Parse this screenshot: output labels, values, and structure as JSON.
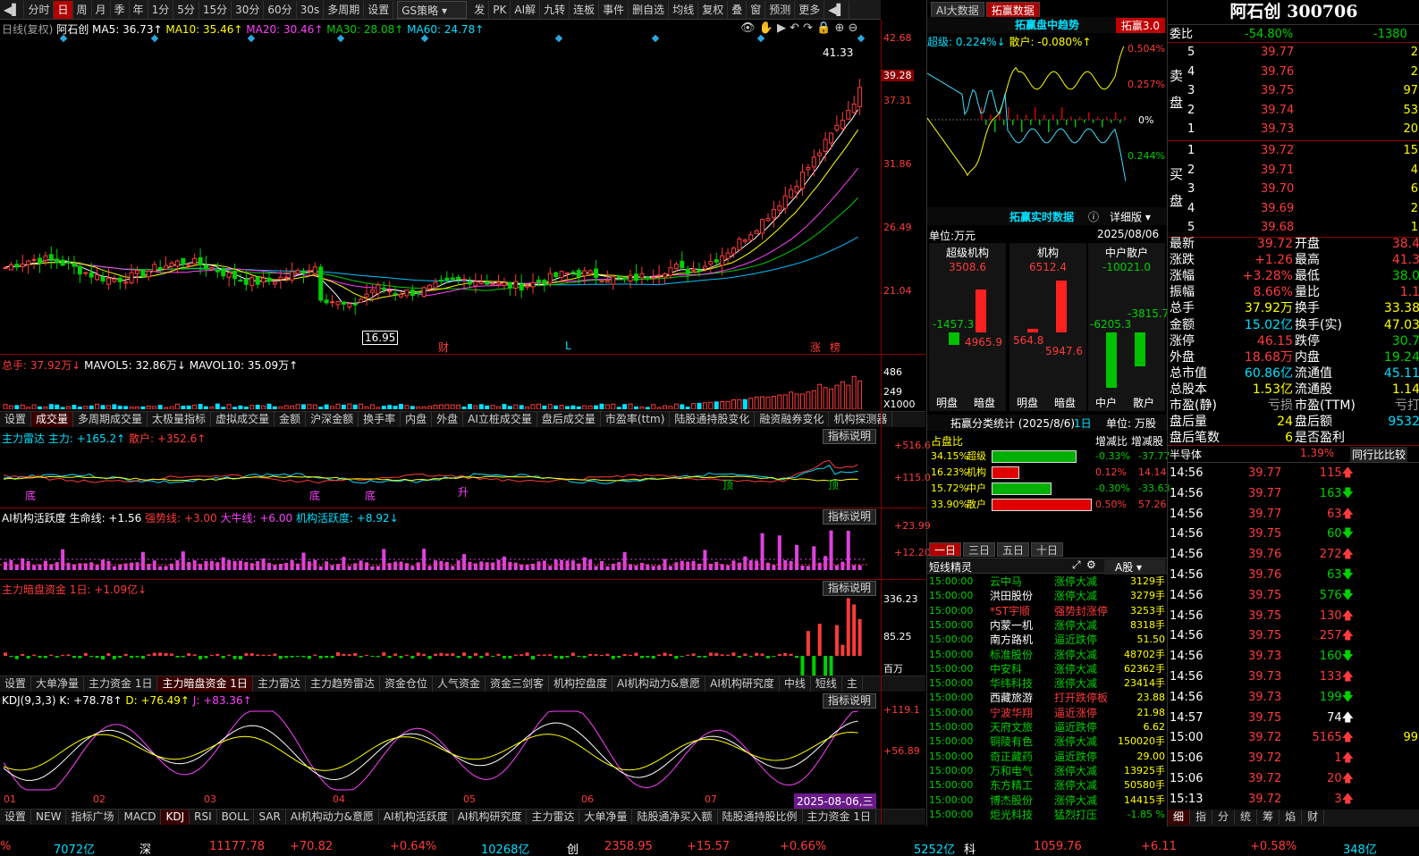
{
  "toolbar": {
    "items": [
      "分时",
      "日",
      "周",
      "月",
      "季",
      "年",
      "1分",
      "5分",
      "15分",
      "30分",
      "60分",
      "30s",
      "多周期",
      "设置"
    ],
    "active_index": 1,
    "strategy": "GS策略",
    "right_items": [
      "发",
      "PK",
      "AI解",
      "九转",
      "连板",
      "事件",
      "删自选",
      "均线",
      "复权",
      "叠",
      "窗",
      "预测",
      "更多"
    ]
  },
  "main": {
    "legend": {
      "prefix": "日线(复权)",
      "name": "阿石创",
      "ma5": "MA5: 36.73↑",
      "ma10": "MA10: 35.46↑",
      "ma20": "MA20: 30.46↑",
      "ma30": "MA30: 28.08↑",
      "ma60": "MA60: 24.78↑"
    },
    "high_label": "41.33",
    "low_label": "16.95",
    "markers": {
      "cai": "财",
      "L": "L",
      "zhang": "涨",
      "bang": "榜"
    },
    "price_axis": [
      "42.68",
      "37.31",
      "31.86",
      "26.49",
      "21.04"
    ],
    "current_price": "39.28"
  },
  "volume": {
    "legend": {
      "total": "总手: 37.92万↓",
      "mavol5": "MAVOL5: 32.86万↓",
      "mavol10": "MAVOL10: 35.09万↑"
    },
    "axis": [
      "486",
      "249"
    ],
    "unit": "X1000",
    "tabs": [
      "设置",
      "成交量",
      "多周期成交量",
      "太极量指标",
      "虚拟成交量",
      "金额",
      "沪深金额",
      "换手率",
      "内盘",
      "外盘",
      "AI立桩成交量",
      "盘后成交量",
      "市盈率(ttm)",
      "陆股通持股变化",
      "融资融券变化",
      "机构探测器"
    ],
    "active_tab": 1
  },
  "radar": {
    "legend": {
      "name": "主力雷达",
      "main": "主力: +165.2↑",
      "retail": "散户: +352.6↑"
    },
    "axis": [
      "+516.6",
      "+115.0"
    ],
    "marks": [
      "底",
      "升",
      "顶"
    ],
    "desc_button": "指标说明"
  },
  "ai_activity": {
    "legend": {
      "name": "AI机构活跃度",
      "life": "生命线: +1.56",
      "strong": "强势线: +3.00",
      "bull": "大牛线: +6.00",
      "act": "机构活跃度: +8.92↓"
    },
    "axis": [
      "+23.99",
      "+12.20"
    ],
    "desc_button": "指标说明"
  },
  "dark_fund": {
    "legend": "主力暗盘资金 1日: +1.09亿↓",
    "axis": [
      "336.23",
      "85.25"
    ],
    "unit": "百万",
    "desc_button": "指标说明",
    "tabs": [
      "设置",
      "大单净量",
      "主力资金 1日",
      "主力暗盘资金 1日",
      "主力雷达",
      "主力趋势雷达",
      "资金仓位",
      "人气资金",
      "资金三剑客",
      "机构控盘度",
      "AI机构动力&意愿",
      "AI机构研究度",
      "中线",
      "短线",
      "主"
    ],
    "active_tab": 3
  },
  "kdj": {
    "legend": {
      "name": "KDJ(9,3,3)",
      "k": "K: +78.78↑",
      "d": "D: +76.49↑",
      "j": "J: +83.36↑"
    },
    "axis": [
      "+119.1",
      "+56.89"
    ],
    "desc_button": "指标说明",
    "months": [
      "01",
      "02",
      "03",
      "04",
      "05",
      "06",
      "07"
    ],
    "date_label": "2025-08-06,三"
  },
  "bottom_tabs": {
    "items": [
      "设置",
      "NEW",
      "指标广场",
      "MACD",
      "KDJ",
      "RSI",
      "BOLL",
      "SAR",
      "AI机构动力&意愿",
      "AI机构活跃度",
      "AI机构研究度",
      "主力雷达",
      "大单净量",
      "陆股通净买入额",
      "陆股通持股比例",
      "主力资金 1日"
    ],
    "active_index": 4
  },
  "mid": {
    "tabs": [
      "AI大数据",
      "拓赢数据"
    ],
    "active_tab": 1,
    "trend_title": "拓赢盘中趋势",
    "trend_badge": "拓赢3.0",
    "super": "超级: 0.224%↓",
    "retail": "散户: -0.080%↑",
    "trend_axis": [
      "0.504%",
      "0.257%",
      "0%",
      "0.244%"
    ],
    "realtime_title": "拓赢实时数据",
    "detail": "详细版",
    "unit": "单位:万元",
    "date": "2025/08/06",
    "cols": [
      {
        "name": "超级机构",
        "top": "3508.6",
        "neg": "-1457.3",
        "pos": "4965.9"
      },
      {
        "name": "机构",
        "top": "6512.4",
        "neg": "564.8",
        "pos": "5947.6"
      },
      {
        "name": "中户散户",
        "top": "-10021.0",
        "neg": "-6205.3",
        "pos": "-3815.7"
      }
    ],
    "col_foot": [
      "明盘",
      "暗盘",
      "明盘",
      "暗盘",
      "中户",
      "散户"
    ],
    "stat_title": "拓赢分类统计 (2025/8/6)",
    "stat_period": "1日",
    "stat_unit": "单位: 万股",
    "stat_head": [
      "占盘比",
      "增减比",
      "增减股"
    ],
    "stats": [
      {
        "pct": "34.15%",
        "name": "超级",
        "chg": "-0.33%",
        "shares": "-37.77",
        "fill": 0.85,
        "color": "#00b000"
      },
      {
        "pct": "16.23%",
        "name": "机构",
        "chg": "0.12%",
        "shares": "14.14",
        "fill": 0.28,
        "color": "#e00000"
      },
      {
        "pct": "15.72%",
        "name": "中户",
        "chg": "-0.30%",
        "shares": "-33.63",
        "fill": 0.6,
        "color": "#00b000"
      },
      {
        "pct": "33.90%",
        "name": "散户",
        "chg": "0.50%",
        "shares": "57.26",
        "fill": 1.0,
        "color": "#e00000"
      }
    ],
    "period_tabs": [
      "一日",
      "三日",
      "五日",
      "十日"
    ],
    "elf_title": "短线精灵",
    "elf_market": "A股",
    "elf_rows": [
      {
        "t": "15:00:00",
        "n": "云中马",
        "e": "涨停大减",
        "v": "3129手"
      },
      {
        "t": "15:00:00",
        "n": "洪田股份",
        "e": "涨停大减",
        "v": "3279手"
      },
      {
        "t": "15:00:00",
        "n": "*ST宇顺",
        "e": "强势封涨停",
        "v": "3253手"
      },
      {
        "t": "15:00:00",
        "n": "内蒙一机",
        "e": "涨停大减",
        "v": "8318手"
      },
      {
        "t": "15:00:00",
        "n": "南方路机",
        "e": "逼近跌停",
        "v": "51.50"
      },
      {
        "t": "15:00:00",
        "n": "标准股份",
        "e": "涨停大减",
        "v": "48702手"
      },
      {
        "t": "15:00:00",
        "n": "中安科",
        "e": "涨停大减",
        "v": "62362手"
      },
      {
        "t": "15:00:00",
        "n": "华纬科技",
        "e": "涨停大减",
        "v": "23414手"
      },
      {
        "t": "15:00:00",
        "n": "西藏旅游",
        "e": "打开跌停板",
        "v": "23.88"
      },
      {
        "t": "15:00:00",
        "n": "宁波华翔",
        "e": "逼近涨停",
        "v": "21.98"
      },
      {
        "t": "15:00:00",
        "n": "天府文旅",
        "e": "逼近跌停",
        "v": "6.62"
      },
      {
        "t": "15:00:00",
        "n": "铜陵有色",
        "e": "涨停大减",
        "v": "150020手"
      },
      {
        "t": "15:00:00",
        "n": "奇正藏药",
        "e": "逼近跌停",
        "v": "29.00"
      },
      {
        "t": "15:00:00",
        "n": "万和电气",
        "e": "涨停大减",
        "v": "13925手"
      },
      {
        "t": "15:00:00",
        "n": "东方精工",
        "e": "涨停大减",
        "v": "50580手"
      },
      {
        "t": "15:00:00",
        "n": "博杰股份",
        "e": "涨停大减",
        "v": "14415手"
      },
      {
        "t": "15:00:00",
        "n": "炬光科技",
        "e": "猛烈打压",
        "v": "-1.85 %"
      }
    ]
  },
  "quote": {
    "title": "阿石创 300706",
    "weibi": {
      "label": "委比",
      "pct": "-54.80%",
      "val": "-1380"
    },
    "sell_label": "卖盘",
    "buy_label": "买盘",
    "sells": [
      {
        "n": "5",
        "p": "39.77",
        "v": "2"
      },
      {
        "n": "4",
        "p": "39.76",
        "v": "2"
      },
      {
        "n": "3",
        "p": "39.75",
        "v": "97"
      },
      {
        "n": "2",
        "p": "39.74",
        "v": "53"
      },
      {
        "n": "1",
        "p": "39.73",
        "v": "20"
      }
    ],
    "buys": [
      {
        "n": "1",
        "p": "39.72",
        "v": "15"
      },
      {
        "n": "2",
        "p": "39.71",
        "v": "4"
      },
      {
        "n": "3",
        "p": "39.70",
        "v": "6"
      },
      {
        "n": "4",
        "p": "39.69",
        "v": "2"
      },
      {
        "n": "5",
        "p": "39.68",
        "v": "1"
      }
    ],
    "stats": [
      {
        "l": "最新",
        "v": "39.72",
        "vc": "red",
        "l2": "开盘",
        "v2": "38.4",
        "v2c": "red"
      },
      {
        "l": "涨跌",
        "v": "+1.26",
        "vc": "red",
        "l2": "最高",
        "v2": "41.3",
        "v2c": "red"
      },
      {
        "l": "涨幅",
        "v": "+3.28%",
        "vc": "red",
        "l2": "最低",
        "v2": "38.0",
        "v2c": "grn"
      },
      {
        "l": "振幅",
        "v": "8.66%",
        "vc": "red",
        "l2": "量比",
        "v2": "1.1",
        "v2c": "red"
      },
      {
        "l": "总手",
        "v": "37.92万",
        "vc": "yel",
        "l2": "换手",
        "v2": "33.38",
        "v2c": "yel"
      },
      {
        "l": "金额",
        "v": "15.02亿",
        "vc": "cyn",
        "l2": "换手(实)",
        "v2": "47.03",
        "v2c": "yel"
      },
      {
        "l": "涨停",
        "v": "46.15",
        "vc": "red",
        "l2": "跌停",
        "v2": "30.7",
        "v2c": "grn"
      },
      {
        "l": "外盘",
        "v": "18.68万",
        "vc": "red",
        "l2": "内盘",
        "v2": "19.24",
        "v2c": "grn"
      },
      {
        "l": "总市值",
        "v": "60.86亿",
        "vc": "cyn",
        "l2": "流通值",
        "v2": "45.11",
        "v2c": "cyn"
      },
      {
        "l": "总股本",
        "v": "1.53亿",
        "vc": "yel",
        "l2": "流通股",
        "v2": "1.14",
        "v2c": "yel"
      },
      {
        "l": "市盈(静)",
        "v": "亏损",
        "vc": "gry",
        "l2": "市盈(TTM)",
        "v2": "亏打",
        "v2c": "gry"
      },
      {
        "l": "盘后量",
        "v": "24",
        "vc": "yel",
        "l2": "盘后额",
        "v2": "9532",
        "v2c": "cyn"
      },
      {
        "l": "盘后笔数",
        "v": "6",
        "vc": "yel",
        "l2": "是否盈利",
        "v2": "",
        "v2c": "gry"
      }
    ],
    "sector": {
      "name": "半导体",
      "pct": "1.39%",
      "btn": "同行比比较"
    },
    "ticks": [
      {
        "t": "14:56",
        "p": "39.77",
        "v": "115",
        "d": "up"
      },
      {
        "t": "14:56",
        "p": "39.77",
        "v": "163",
        "d": "down"
      },
      {
        "t": "14:56",
        "p": "39.77",
        "v": "63",
        "d": "up"
      },
      {
        "t": "14:56",
        "p": "39.75",
        "v": "60",
        "d": "down"
      },
      {
        "t": "14:56",
        "p": "39.76",
        "v": "272",
        "d": "up"
      },
      {
        "t": "14:56",
        "p": "39.76",
        "v": "63",
        "d": "down"
      },
      {
        "t": "14:56",
        "p": "39.75",
        "v": "576",
        "d": "down"
      },
      {
        "t": "14:56",
        "p": "39.75",
        "v": "130",
        "d": "up"
      },
      {
        "t": "14:56",
        "p": "39.75",
        "v": "257",
        "d": "up"
      },
      {
        "t": "14:56",
        "p": "39.73",
        "v": "160",
        "d": "down"
      },
      {
        "t": "14:56",
        "p": "39.73",
        "v": "133",
        "d": "up"
      },
      {
        "t": "14:56",
        "p": "39.73",
        "v": "199",
        "d": "down"
      },
      {
        "t": "14:57",
        "p": "39.75",
        "v": "74",
        "d": "up-w"
      },
      {
        "t": "15:00",
        "p": "39.72",
        "v": "5165",
        "d": "up",
        "x": "99"
      },
      {
        "t": "15:06",
        "p": "39.72",
        "v": "1",
        "d": "up"
      },
      {
        "t": "15:06",
        "p": "39.72",
        "v": "20",
        "d": "up"
      },
      {
        "t": "15:13",
        "p": "39.72",
        "v": "3",
        "d": "up"
      }
    ],
    "bottom_tabs": [
      "细",
      "指",
      "分",
      "统",
      "筹",
      "焰",
      "财"
    ]
  },
  "ticker": {
    "items": [
      {
        "t": "%",
        "c": "red"
      },
      {
        "t": "7072亿",
        "c": "cyn"
      },
      {
        "t": "深",
        "c": "wht"
      },
      {
        "t": "11177.78",
        "c": "red"
      },
      {
        "t": "+70.82",
        "c": "red"
      },
      {
        "t": "+0.64%",
        "c": "red"
      },
      {
        "t": "10268亿",
        "c": "cyn"
      },
      {
        "t": "创",
        "c": "wht"
      },
      {
        "t": "2358.95",
        "c": "red"
      },
      {
        "t": "+15.57",
        "c": "red"
      },
      {
        "t": "+0.66%",
        "c": "red"
      },
      {
        "t": "5252亿",
        "c": "cyn"
      },
      {
        "t": "科",
        "c": "wht"
      },
      {
        "t": "1059.76",
        "c": "red"
      },
      {
        "t": "+6.11",
        "c": "red"
      },
      {
        "t": "+0.58%",
        "c": "red"
      },
      {
        "t": "348亿",
        "c": "cyn"
      }
    ]
  },
  "colors": {
    "up": "#ff3b3b",
    "down": "#00d000",
    "border": "#8b0000",
    "ma5": "#ffffff",
    "ma10": "#ffff00",
    "ma20": "#ff40ff",
    "ma30": "#00d000",
    "ma60": "#00c0ff"
  }
}
